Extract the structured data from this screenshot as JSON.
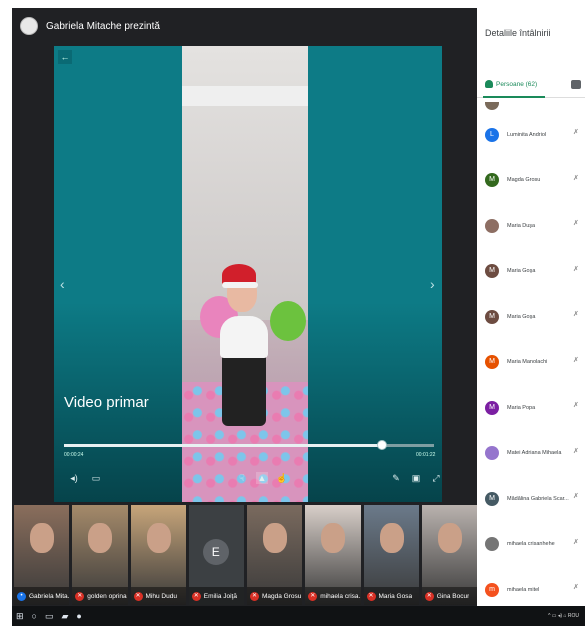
{
  "header": {
    "presenter_title": "Gabriela Mitache prezintă"
  },
  "stage": {
    "title": "Video primar",
    "time_elapsed": "00:00:24",
    "time_total": "00:01:22",
    "progress": 0.86
  },
  "panel": {
    "title": "Detaliile întâlnirii",
    "people_tab_label": "Persoane (62)",
    "people": [
      {
        "name": "Luminita Andriol",
        "initial": "L",
        "avatar_color": "#1a73e8"
      },
      {
        "name": "Magda Grosu",
        "initial": "M",
        "avatar_color": "#33691e"
      },
      {
        "name": "Maria Duşa",
        "initial": "",
        "avatar_color": "#8d6e63"
      },
      {
        "name": "Maria Goşa",
        "initial": "M",
        "avatar_color": "#6d4c41"
      },
      {
        "name": "Maria Goşa",
        "initial": "M",
        "avatar_color": "#6d4c41"
      },
      {
        "name": "Maria Manolachi",
        "initial": "M",
        "avatar_color": "#e65100"
      },
      {
        "name": "Maria Popa",
        "initial": "M",
        "avatar_color": "#7b1fa2"
      },
      {
        "name": "Matei Adriana Mihaela",
        "initial": "",
        "avatar_color": "#9575cd"
      },
      {
        "name": "Mădălina Gabriela Scar...",
        "initial": "M",
        "avatar_color": "#455a64"
      },
      {
        "name": "mihaela crisanhehe",
        "initial": "",
        "avatar_color": "#757575"
      },
      {
        "name": "mihaela mitel",
        "initial": "m",
        "avatar_color": "#f4511e"
      }
    ]
  },
  "filmstrip": [
    {
      "name": "Gabriela Mita...",
      "muted": false,
      "color": "#8a6e5c"
    },
    {
      "name": "golden oprina",
      "muted": true,
      "color": "#a58a6a"
    },
    {
      "name": "Mihu Dudu",
      "muted": true,
      "color": "#c7a57a"
    },
    {
      "name": "Emilia Joiţă",
      "muted": true,
      "initial": "E"
    },
    {
      "name": "Magda Grosu",
      "muted": true,
      "color": "#7a6a5e"
    },
    {
      "name": "mihaela crisa...",
      "muted": true,
      "color": "#d8cfc9"
    },
    {
      "name": "Maria Gosa",
      "muted": true,
      "color": "#6b7a8a"
    },
    {
      "name": "Gina Bocur",
      "muted": true,
      "color": "#b9b2ae"
    }
  ]
}
